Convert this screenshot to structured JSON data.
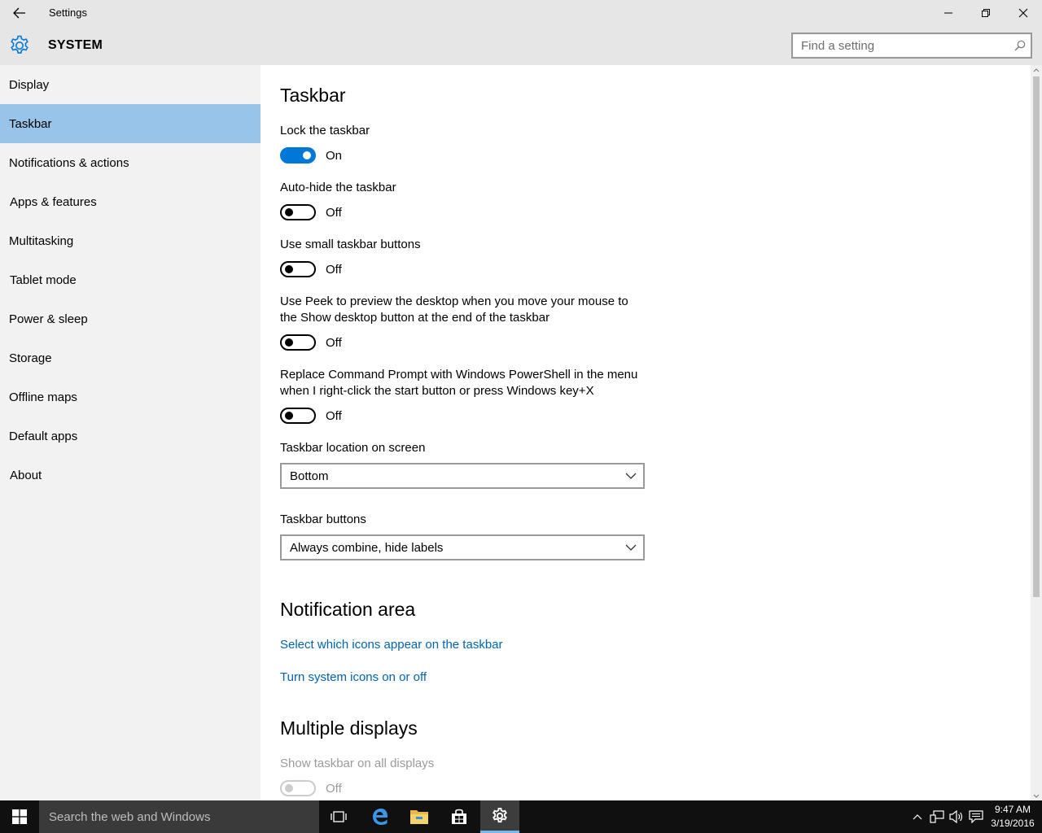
{
  "window": {
    "title": "Settings",
    "section": "SYSTEM",
    "search_placeholder": "Find a setting"
  },
  "sidebar": {
    "items": [
      {
        "label": "Display",
        "active": false
      },
      {
        "label": "Taskbar",
        "active": true
      },
      {
        "label": "Notifications & actions",
        "active": false
      },
      {
        "label": "Apps & features",
        "active": false
      },
      {
        "label": "Multitasking",
        "active": false
      },
      {
        "label": "Tablet mode",
        "active": false
      },
      {
        "label": "Power & sleep",
        "active": false
      },
      {
        "label": "Storage",
        "active": false
      },
      {
        "label": "Offline maps",
        "active": false
      },
      {
        "label": "Default apps",
        "active": false
      },
      {
        "label": "About",
        "active": false
      }
    ]
  },
  "content": {
    "heading": "Taskbar",
    "toggles": [
      {
        "label": "Lock the taskbar",
        "state": "On"
      },
      {
        "label": "Auto-hide the taskbar",
        "state": "Off"
      },
      {
        "label": "Use small taskbar buttons",
        "state": "Off"
      },
      {
        "label_line1": "Use Peek to preview the desktop when you move your mouse to",
        "label_line2": "the Show desktop button at the end of the taskbar",
        "state": "Off"
      },
      {
        "label_line1": "Replace Command Prompt with Windows PowerShell in the menu",
        "label_line2": "when I right-click the start button or press Windows key+X",
        "state": "Off"
      }
    ],
    "location": {
      "label": "Taskbar location on screen",
      "value": "Bottom"
    },
    "buttons": {
      "label": "Taskbar buttons",
      "value": "Always combine, hide labels"
    },
    "notification_area": {
      "heading": "Notification area",
      "link1": "Select which icons appear on the taskbar",
      "link2": "Turn system icons on or off"
    },
    "multiple_displays": {
      "heading": "Multiple displays",
      "label": "Show taskbar on all displays",
      "state": "Off"
    }
  },
  "taskbar": {
    "search_text": "Search the web and Windows",
    "time": "9:47 AM",
    "date": "3/19/2016",
    "pinned_icons": [
      "task-view-icon",
      "edge-icon",
      "file-explorer-icon",
      "store-icon",
      "settings-icon"
    ],
    "tray_icons": [
      "chevron-up-icon",
      "network-icon",
      "volume-icon",
      "action-center-icon"
    ]
  },
  "colors": {
    "accent": "#0078d7",
    "link": "#0063b1",
    "selected_nav": "#99c4ea",
    "sidebar_bg": "#f2f2f2",
    "titlebar_bg": "#e6e6e6",
    "taskbar_bg": "#101010"
  }
}
